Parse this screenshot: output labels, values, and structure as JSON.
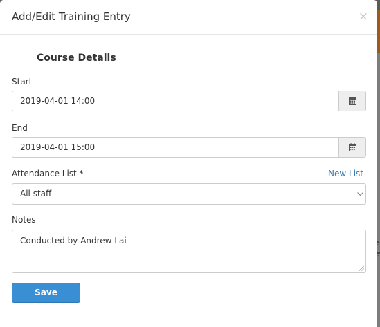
{
  "modal": {
    "title": "Add/Edit Training Entry",
    "close_glyph": "×"
  },
  "section": {
    "legend": "Course Details"
  },
  "fields": {
    "start": {
      "label": "Start",
      "value": "2019-04-01 14:00",
      "icon": "calendar-icon"
    },
    "end": {
      "label": "End",
      "value": "2019-04-01 15:00",
      "icon": "calendar-icon"
    },
    "attendance": {
      "label": "Attendance List *",
      "selected": "All staff",
      "new_list_link": "New List"
    },
    "notes": {
      "label": "Notes",
      "value": "Conducted by Andrew Lai"
    }
  },
  "actions": {
    "save_label": "Save"
  },
  "background": {
    "stub_lines": [
      "e",
      "ev"
    ]
  },
  "colors": {
    "primary_button": "#3a8ed3",
    "link": "#337ab7",
    "addon_bg": "#eeeeee"
  }
}
